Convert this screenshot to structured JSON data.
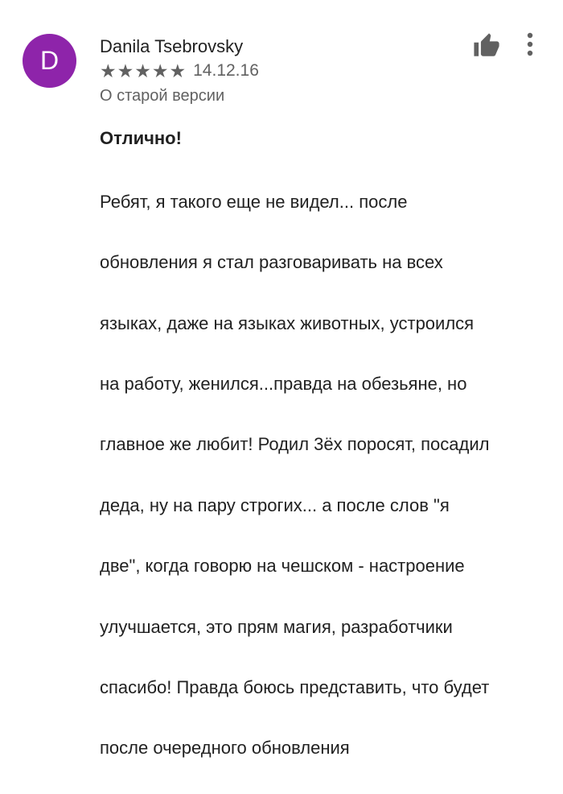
{
  "review": {
    "avatar_letter": "D",
    "avatar_color": "#8e24aa",
    "author": "Danila Tsebrovsky",
    "rating": 5,
    "stars": [
      "★",
      "★",
      "★",
      "★",
      "★"
    ],
    "date": "14.12.16",
    "version_note": "О старой версии",
    "title": "Отлично!",
    "text_lines": [
      "Ребят, я такого еще не видел... после",
      "обновления я стал разговаривать на всех",
      "языках, даже на языках животных, устроился",
      "на работу, женился...правда на обезьяне, но",
      "главное же любит! Родил 3ёх поросят, посадил",
      "деда, ну на пару строгих... а после слов \"я",
      "две\", когда говорю на чешском - настроение",
      "улучшается, это прям магия, разработчики",
      "спасибо! Правда боюсь представить, что будет",
      "после очередного обновления"
    ]
  },
  "icons": {
    "like": "thumbs-up-icon",
    "more": "more-vert-icon",
    "star": "star-icon"
  }
}
